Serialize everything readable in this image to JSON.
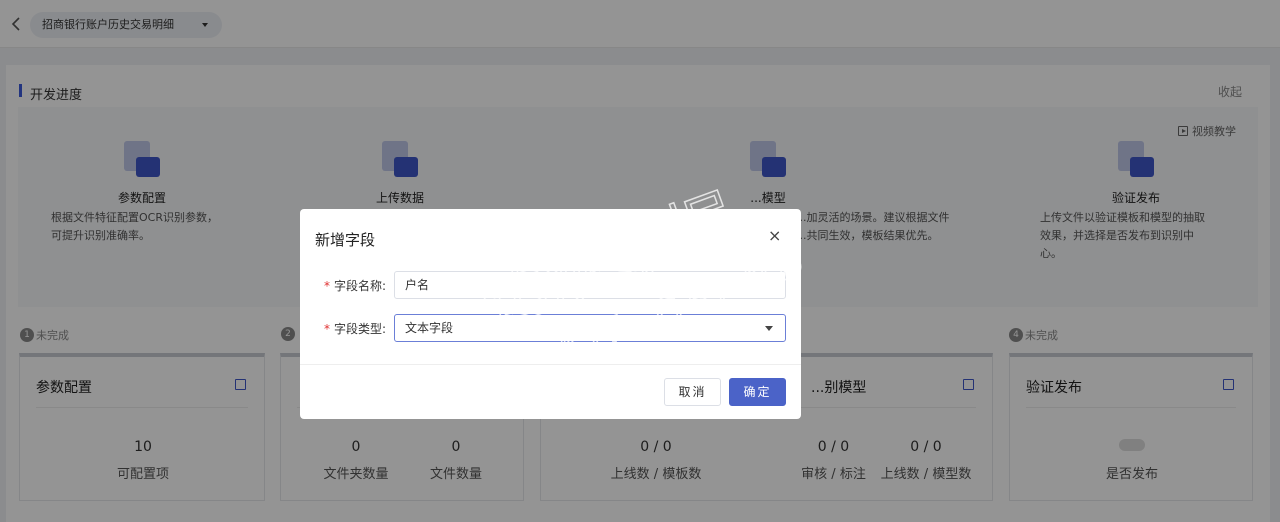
{
  "topbar": {
    "project_name": "招商银行账户历史交易明细"
  },
  "panel": {
    "title": "开发进度",
    "collapse_label": "收起",
    "video_label": "视频教学"
  },
  "steps": [
    {
      "title": "参数配置",
      "desc1": "根据文件特征配置OCR识别参数，",
      "desc2": "可提升识别准确率。"
    },
    {
      "title": "上传数据"
    },
    {
      "title": "...模型",
      "desc1": "...加灵活的场景。建议根据文件",
      "desc2": "...共同生效，模板结果优先。"
    },
    {
      "title": "验证发布",
      "desc1": "上传文件以验证模板和模型的抽取",
      "desc2": "效果，并选择是否发布到识别中",
      "desc3": "心。"
    }
  ],
  "statuses": [
    {
      "num": "1",
      "label": "未完成"
    },
    {
      "num": "2",
      "label": ""
    },
    {
      "num": "4",
      "label": "未完成"
    }
  ],
  "cards": {
    "c1": {
      "title": "参数配置",
      "v1": "10",
      "l1": "可配置项"
    },
    "c2": {
      "v1": "0",
      "l1": "文件夹数量",
      "v2": "0",
      "l2": "文件数量"
    },
    "c3": {
      "v1": "0 / 0",
      "l1": "上线数 / 模板数"
    },
    "c4": {
      "title": "...别模型",
      "v1": "0 / 0",
      "l1": "审核 / 标注",
      "v2": "0 / 0",
      "l2": "上线数 / 模型数"
    },
    "c5": {
      "title": "验证发布",
      "l1": "是否发布"
    }
  },
  "modal": {
    "title": "新增字段",
    "close_glyph": "×",
    "name_label": "字段名称:",
    "name_value": "户名",
    "type_label": "字段类型:",
    "type_value": "文本字段",
    "cancel_label": "取消",
    "ok_label": "确定"
  },
  "watermark": {
    "cn": "达观数据",
    "en": "DATA GRAND"
  }
}
